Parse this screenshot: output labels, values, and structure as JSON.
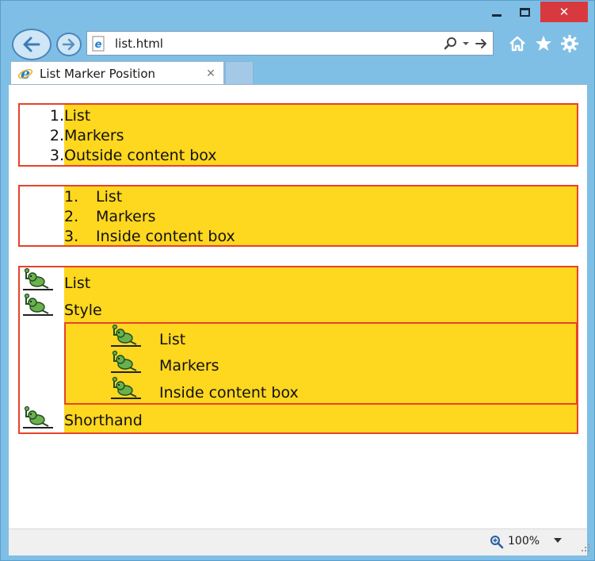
{
  "window": {
    "minimize_icon": "minimize-icon",
    "maximize_icon": "maximize-icon",
    "close_label": "✕"
  },
  "nav": {
    "address": "list.html",
    "icons": [
      "back-arrow-icon",
      "forward-arrow-icon",
      "search-icon",
      "dropdown-icon",
      "go-arrow-icon",
      "home-icon",
      "favorites-star-icon",
      "settings-gear-icon"
    ]
  },
  "tab": {
    "title": "List Marker Position",
    "close_label": "✕"
  },
  "lists": {
    "outside": {
      "markers": [
        "1.",
        "2.",
        "3."
      ],
      "items": [
        "List",
        "Markers",
        "Outside content box"
      ]
    },
    "inside": {
      "markers": [
        "1.",
        "2.",
        "3."
      ],
      "items": [
        "List",
        "Markers",
        "Inside content box"
      ]
    },
    "shorthand": {
      "marker_image": "goblin-thumbs-up-icon",
      "items_before": [
        "List",
        "Style"
      ],
      "nested_items": [
        "List",
        "Markers",
        "Inside content box"
      ],
      "items_after": [
        "Shorthand"
      ]
    }
  },
  "colors": {
    "list_background": "#fed71f",
    "list_border": "#e8422a",
    "chrome": "#7fbfe6",
    "close_button": "#d8393f"
  },
  "status": {
    "zoom": "100%"
  }
}
